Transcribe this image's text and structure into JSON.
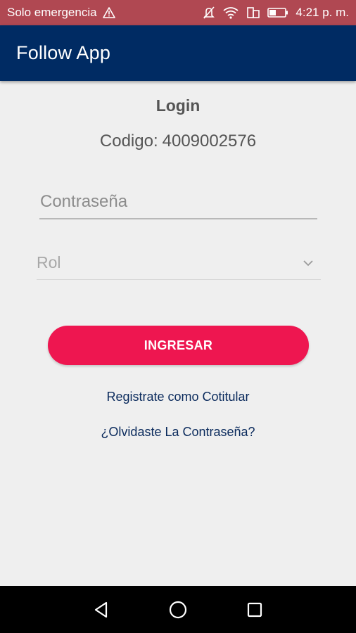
{
  "status_bar": {
    "carrier_text": "Solo emergencia",
    "time": "4:21 p. m.",
    "icons": [
      "warning-icon",
      "mute-icon",
      "wifi-icon",
      "sim-icon",
      "battery-icon"
    ]
  },
  "app_bar": {
    "title": "Follow App",
    "color": "#002b63"
  },
  "login": {
    "title": "Login",
    "codigo_label": "Codigo:",
    "codigo_value": "4009002576",
    "password_placeholder": "Contraseña",
    "rol_value": "Rol",
    "submit_label": "INGRESAR",
    "submit_color": "#ee1650",
    "register_link": "Registrate como Cotitular",
    "forgot_link": "¿Olvidaste La Contraseña?"
  },
  "nav_bar": {
    "icons": [
      "back-icon",
      "home-icon",
      "recents-icon"
    ]
  }
}
